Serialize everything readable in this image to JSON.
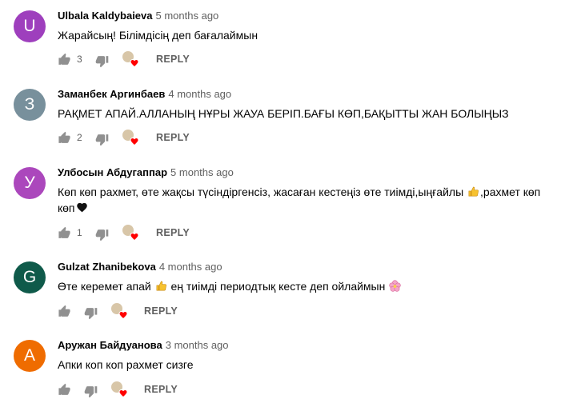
{
  "comments": [
    {
      "avatar_letter": "U",
      "avatar_color": "#9e3fbd",
      "author": "Ulbala Kaldybaieva",
      "time": "5 months ago",
      "text_parts": [
        "Жарайсың! Білімдісің деп бағалаймын"
      ],
      "likes": "3",
      "reply": "REPLY"
    },
    {
      "avatar_letter": "З",
      "avatar_color": "#78909c",
      "author": "Заманбек Аргинбаев",
      "time": "4 months ago",
      "text_parts": [
        "РАҚМЕТ АПАЙ.АЛЛАНЫҢ НҰРЫ ЖАУА БЕРІП.БАҒЫ КӨП,БАҚЫТТЫ ЖАН БОЛЫҢЫЗ"
      ],
      "likes": "2",
      "reply": "REPLY"
    },
    {
      "avatar_letter": "У",
      "avatar_color": "#ab47bc",
      "author": "Улбосын Абдугаппар",
      "time": "5 months ago",
      "text_parts": [
        "Көп көп рахмет, өте жақсы түсіндіргенсіз, жасаған кестеңіз өте тиімді,ыңғайлы ",
        ",рахмет көп көп"
      ],
      "likes": "1",
      "reply": "REPLY"
    },
    {
      "avatar_letter": "G",
      "avatar_color": "#0f5a4a",
      "author": "Gulzat Zhanibekova",
      "time": "4 months ago",
      "text_parts": [
        "Өте керемет апай ",
        " ең тиімді периодтық кесте деп ойлаймын "
      ],
      "likes": "",
      "reply": "REPLY"
    },
    {
      "avatar_letter": "А",
      "avatar_color": "#ef6c00",
      "author": "Аружан Байдуанова",
      "time": "3 months ago",
      "text_parts": [
        "Апки коп коп рахмет сизге"
      ],
      "likes": "",
      "reply": "REPLY"
    }
  ],
  "icons": {
    "like": "thumb-up-icon",
    "dislike": "thumb-down-icon",
    "creator_heart": "creator-heart-icon",
    "thumbs_up_emoji": "thumbs-up-emoji",
    "black_heart_emoji": "black-heart-emoji",
    "blossom_emoji": "blossom-emoji"
  }
}
